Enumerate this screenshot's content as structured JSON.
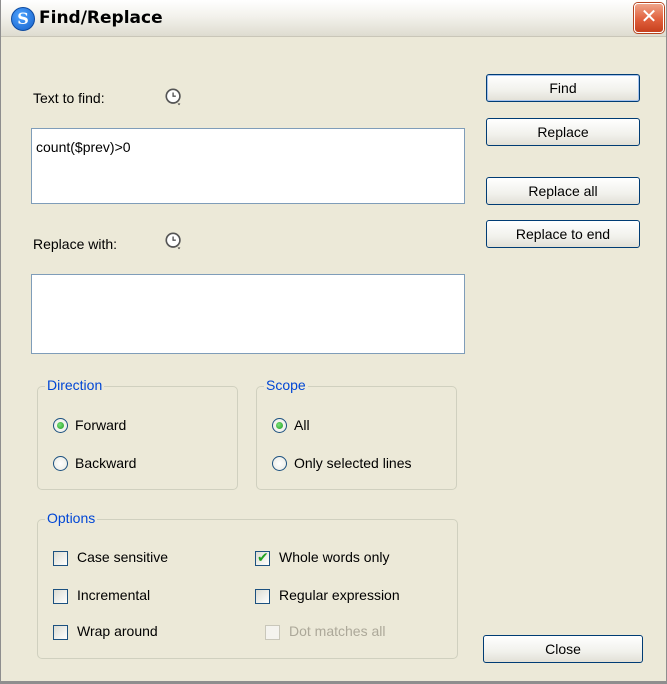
{
  "window": {
    "title": "Find/Replace",
    "app_icon_glyph": "S",
    "close_glyph": "✕"
  },
  "find": {
    "label": "Text to find:",
    "value": "count($prev)>0",
    "history_icon": "history-dropdown-icon"
  },
  "replace": {
    "label": "Replace with:",
    "value": "",
    "history_icon": "history-dropdown-icon"
  },
  "direction": {
    "title": "Direction",
    "options": [
      "Forward",
      "Backward"
    ],
    "selected": "Forward"
  },
  "scope": {
    "title": "Scope",
    "options": [
      "All",
      "Only selected lines"
    ],
    "selected": "All"
  },
  "options": {
    "title": "Options",
    "case_sensitive": {
      "label": "Case sensitive",
      "checked": false
    },
    "incremental": {
      "label": "Incremental",
      "checked": false
    },
    "wrap_around": {
      "label": "Wrap around",
      "checked": false
    },
    "whole_words": {
      "label": "Whole words only",
      "checked": true
    },
    "regex": {
      "label": "Regular expression",
      "checked": false
    },
    "dot_matches_all": {
      "label": "Dot matches all",
      "checked": false,
      "disabled": true
    }
  },
  "buttons": {
    "find": "Find",
    "replace": "Replace",
    "replace_all": "Replace all",
    "replace_to_end": "Replace to end",
    "close": "Close"
  },
  "colors": {
    "dialog_bg": "#ece9d8",
    "group_title": "#0046d5",
    "button_border": "#003c74"
  }
}
